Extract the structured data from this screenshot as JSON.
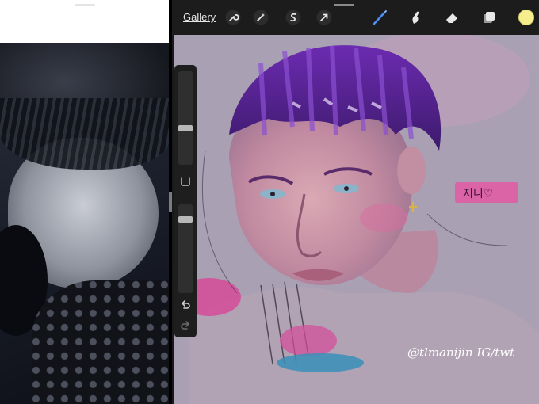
{
  "reference_pane": {
    "content": "black-and-white reference photo"
  },
  "toolbar": {
    "gallery_label": "Gallery",
    "icons": [
      "wrench-icon",
      "magic-wand-icon",
      "selection-icon",
      "transform-arrow-icon",
      "brush-icon",
      "smudge-icon",
      "eraser-icon",
      "layers-icon"
    ],
    "active_tool": "brush",
    "current_color": "#f6ee8c"
  },
  "sidebar": {
    "brush_size_level": 0.38,
    "opacity_level": 0.14
  },
  "canvas": {
    "background_color": "#a9a0b3",
    "signature": "@tlmanijin IG/twt",
    "sticky_note": "저니♡"
  }
}
